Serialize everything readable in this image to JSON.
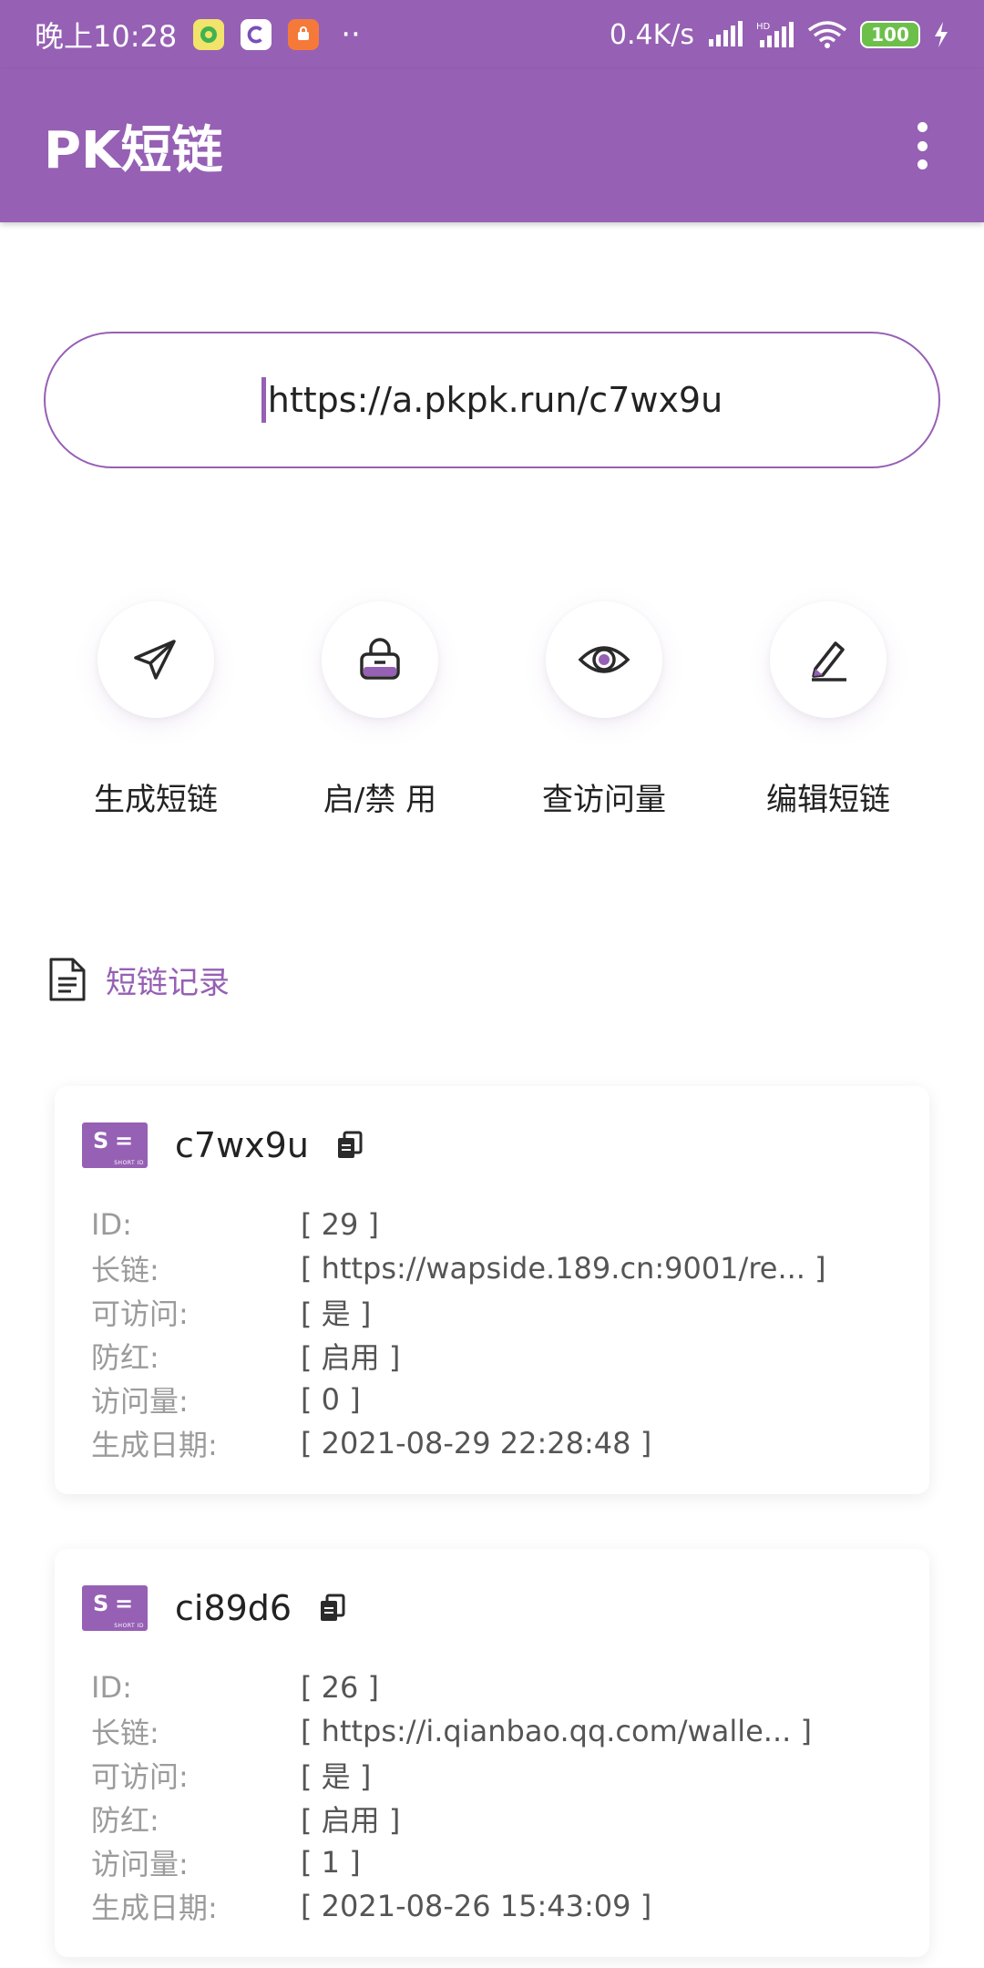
{
  "status_bar": {
    "time": "晚上10:28",
    "speed": "0.4K/s",
    "battery": "100",
    "dots": "··"
  },
  "app_bar": {
    "title": "PK短链"
  },
  "url_input": {
    "value": "https://a.pkpk.run/c7wx9u"
  },
  "actions": [
    {
      "label": "生成短链",
      "icon": "paper-plane-icon"
    },
    {
      "label": "启/禁 用",
      "icon": "lock-icon"
    },
    {
      "label": "查访问量",
      "icon": "eye-icon"
    },
    {
      "label": "编辑短链",
      "icon": "pencil-icon"
    }
  ],
  "records": {
    "title": "短链记录",
    "field_labels": {
      "id": "ID:",
      "long_url": "长链:",
      "accessible": "可访问:",
      "anti_red": "防红:",
      "visits": "访问量:",
      "created": "生成日期:"
    },
    "items": [
      {
        "code": "c7wx9u",
        "id": "[ 29 ]",
        "long_url": "[ https://wapside.189.cn:9001/re... ]",
        "accessible": "[ 是 ]",
        "anti_red": "[ 启用 ]",
        "visits": "[ 0 ]",
        "created": "[ 2021-08-29 22:28:48 ]"
      },
      {
        "code": "ci89d6",
        "id": "[ 26 ]",
        "long_url": "[ https://i.qianbao.qq.com/walle... ]",
        "accessible": "[ 是 ]",
        "anti_red": "[ 启用 ]",
        "visits": "[ 1 ]",
        "created": "[ 2021-08-26 15:43:09 ]"
      }
    ]
  },
  "colors": {
    "accent": "#9660b4",
    "battery": "#6cc04a"
  }
}
